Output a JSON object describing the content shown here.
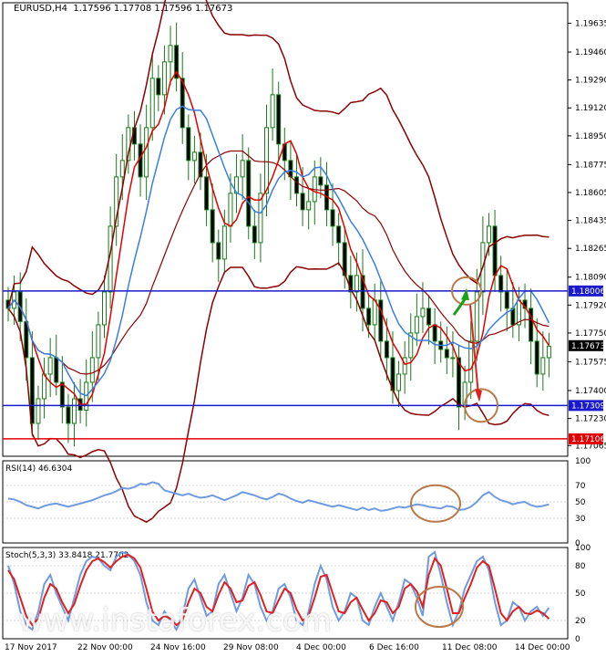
{
  "window": {
    "symbol_line": "EURUSD,H4  1.17596 1.17708 1.17596 1.17673",
    "watermark": "www.instaforex.com"
  },
  "chart_data": [
    {
      "type": "candlestick",
      "title": "EURUSD,H4  1.17596 1.17708 1.17596 1.17673",
      "ylim": [
        1.17,
        1.1976
      ],
      "y_ticks": [
        "1.19635",
        "1.19460",
        "1.19290",
        "1.19120",
        "1.18950",
        "1.18775",
        "1.18605",
        "1.18435",
        "1.18265",
        "1.18090",
        "1.17920",
        "1.17750",
        "1.17575",
        "1.17400",
        "1.17230",
        "1.17065"
      ],
      "x_labels": [
        "17 Nov 2017",
        "22 Nov 00:00",
        "24 Nov 16:00",
        "29 Nov 08:00",
        "4 Dec 00:00",
        "6 Dec 16:00",
        "11 Dec 08:00",
        "14 Dec 00:00"
      ],
      "price_marker": {
        "label": "1.17673",
        "value": 1.17673
      },
      "levels": [
        {
          "label": "1.18006",
          "value": 1.18006,
          "color": "#1a1acc"
        },
        {
          "label": "1.17309",
          "value": 1.17309,
          "color": "#1a1acc"
        },
        {
          "label": "1.17106",
          "value": 1.17106,
          "color": "#e00000"
        }
      ],
      "close": [
        1.179,
        1.18,
        1.1782,
        1.176,
        1.172,
        1.1735,
        1.175,
        1.176,
        1.1745,
        1.173,
        1.172,
        1.1735,
        1.1728,
        1.1745,
        1.176,
        1.178,
        1.18,
        1.184,
        1.187,
        1.188,
        1.19,
        1.189,
        1.187,
        1.19,
        1.193,
        1.192,
        1.194,
        1.195,
        1.193,
        1.19,
        1.188,
        1.1885,
        1.187,
        1.185,
        1.183,
        1.182,
        1.184,
        1.186,
        1.187,
        1.188,
        1.184,
        1.183,
        1.186,
        1.19,
        1.192,
        1.189,
        1.188,
        1.187,
        1.186,
        1.185,
        1.1855,
        1.187,
        1.1865,
        1.185,
        1.184,
        1.183,
        1.181,
        1.18,
        1.181,
        1.179,
        1.178,
        1.1795,
        1.177,
        1.176,
        1.174,
        1.175,
        1.176,
        1.1775,
        1.1785,
        1.179,
        1.178,
        1.177,
        1.1765,
        1.176,
        1.176,
        1.173,
        1.1745,
        1.177,
        1.18,
        1.183,
        1.184,
        1.181,
        1.18,
        1.179,
        1.178,
        1.1795,
        1.179,
        1.177,
        1.175,
        1.176,
        1.1767
      ],
      "bollinger_note": "Bollinger Bands (dark red), MA (red), MA (blue)"
    },
    {
      "type": "line",
      "title": "RSI(14) 46.6304",
      "ylim": [
        0,
        100
      ],
      "y_ticks": [
        "100",
        "70",
        "50",
        "30",
        "0"
      ],
      "values": [
        54,
        53,
        50,
        46,
        44,
        42,
        45,
        47,
        48,
        46,
        44,
        46,
        48,
        50,
        52,
        55,
        58,
        60,
        63,
        67,
        66,
        68,
        72,
        71,
        74,
        72,
        64,
        62,
        60,
        58,
        60,
        57,
        55,
        56,
        58,
        55,
        52,
        55,
        58,
        62,
        60,
        58,
        55,
        53,
        56,
        60,
        58,
        54,
        51,
        49,
        52,
        50,
        48,
        46,
        44,
        46,
        44,
        42,
        40,
        43,
        40,
        42,
        39,
        40,
        42,
        44,
        43,
        45,
        47,
        46,
        44,
        43,
        42,
        45,
        44,
        40,
        41,
        44,
        50,
        58,
        62,
        56,
        52,
        50,
        47,
        49,
        50,
        46,
        44,
        45,
        47
      ]
    },
    {
      "type": "line",
      "title": "Stoch(5,3,3) 33.8418 21.7702",
      "ylim": [
        0,
        100
      ],
      "y_ticks": [
        "100",
        "80",
        "50",
        "20",
        "0"
      ],
      "series": [
        {
          "color": "#6f9be0",
          "values": [
            80,
            60,
            30,
            15,
            10,
            30,
            60,
            70,
            50,
            35,
            20,
            45,
            70,
            85,
            90,
            88,
            80,
            75,
            90,
            95,
            92,
            85,
            70,
            40,
            20,
            15,
            30,
            20,
            10,
            25,
            55,
            65,
            45,
            25,
            30,
            60,
            70,
            50,
            30,
            45,
            70,
            60,
            35,
            20,
            30,
            55,
            60,
            45,
            20,
            15,
            30,
            60,
            80,
            65,
            35,
            20,
            30,
            50,
            45,
            20,
            15,
            35,
            50,
            35,
            20,
            40,
            65,
            60,
            45,
            25,
            90,
            95,
            70,
            40,
            15,
            30,
            55,
            70,
            85,
            90,
            75,
            40,
            15,
            20,
            40,
            35,
            20,
            30,
            35,
            25,
            34
          ]
        },
        {
          "color": "#e02020",
          "values": [
            75,
            65,
            45,
            25,
            15,
            22,
            45,
            60,
            55,
            40,
            28,
            38,
            58,
            75,
            85,
            88,
            84,
            78,
            85,
            90,
            92,
            88,
            78,
            55,
            30,
            20,
            25,
            22,
            15,
            20,
            40,
            55,
            50,
            35,
            30,
            48,
            62,
            55,
            40,
            42,
            58,
            62,
            48,
            30,
            28,
            42,
            55,
            50,
            32,
            20,
            25,
            45,
            68,
            70,
            50,
            30,
            28,
            40,
            45,
            32,
            20,
            28,
            42,
            40,
            28,
            35,
            55,
            60,
            52,
            35,
            70,
            88,
            80,
            55,
            28,
            28,
            45,
            60,
            78,
            85,
            80,
            55,
            28,
            20,
            30,
            35,
            28,
            27,
            31,
            28,
            22
          ]
        }
      ]
    }
  ]
}
